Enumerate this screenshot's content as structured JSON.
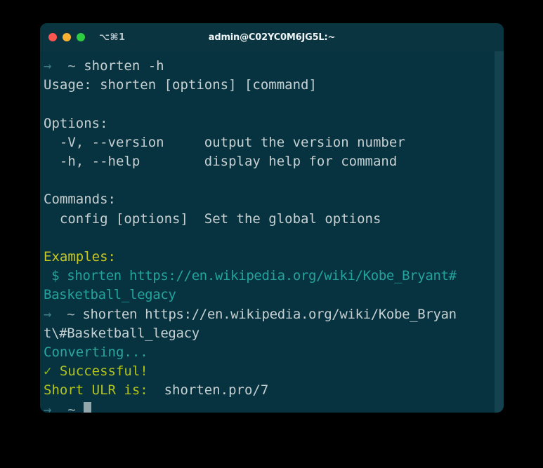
{
  "window": {
    "title": "admin@C02YC0M6JG5L:~",
    "tab_shortcut": "⌥⌘1",
    "traffic_lights": {
      "close": "close-button",
      "minimize": "minimize-button",
      "maximize": "maximize-button"
    },
    "colors": {
      "background": "#06333f",
      "titlebar": "#0a3440",
      "desktop": "#000000",
      "text": "#c6d0d2",
      "teal": "#23a39c",
      "yellow": "#c8c820",
      "olive": "#b3c41c",
      "arrow": "#41808a",
      "scrollbar": "#14424f",
      "red_light": "#f9564f",
      "yellow_light": "#f9b132",
      "green_light": "#2ecc40"
    }
  },
  "terminal": {
    "lines": [
      {
        "id": "prompt-help",
        "segments": [
          {
            "text": "→",
            "class": "arrow"
          },
          {
            "text": "  ",
            "class": "plain"
          },
          {
            "text": "~",
            "class": "tilde"
          },
          {
            "text": " shorten -h",
            "class": "plain"
          }
        ]
      },
      {
        "id": "usage",
        "segments": [
          {
            "text": "Usage: shorten [options] [command]",
            "class": "plain"
          }
        ]
      },
      {
        "id": "blank-1",
        "segments": [
          {
            "text": " ",
            "class": "plain"
          }
        ]
      },
      {
        "id": "options-header",
        "segments": [
          {
            "text": "Options:",
            "class": "plain"
          }
        ]
      },
      {
        "id": "option-version",
        "segments": [
          {
            "text": "  -V, --version     output the version number",
            "class": "plain"
          }
        ]
      },
      {
        "id": "option-help",
        "segments": [
          {
            "text": "  -h, --help        display help for command",
            "class": "plain"
          }
        ]
      },
      {
        "id": "blank-2",
        "segments": [
          {
            "text": " ",
            "class": "plain"
          }
        ]
      },
      {
        "id": "commands-header",
        "segments": [
          {
            "text": "Commands:",
            "class": "plain"
          }
        ]
      },
      {
        "id": "command-config",
        "segments": [
          {
            "text": "  config [options]  Set the global options",
            "class": "plain"
          }
        ]
      },
      {
        "id": "blank-3",
        "segments": [
          {
            "text": " ",
            "class": "plain"
          }
        ]
      },
      {
        "id": "examples-header",
        "segments": [
          {
            "text": "Examples:",
            "class": "yellow"
          }
        ]
      },
      {
        "id": "example-command",
        "wrap": true,
        "segments": [
          {
            "text": " $ shorten https://en.wikipedia.org/wiki/Kobe_Bryant#",
            "class": "teal"
          }
        ]
      },
      {
        "id": "example-command-wrap",
        "wrap": true,
        "segments": [
          {
            "text": "Basketball_legacy",
            "class": "teal"
          }
        ]
      },
      {
        "id": "prompt-shorten",
        "wrap": true,
        "segments": [
          {
            "text": "→",
            "class": "arrow"
          },
          {
            "text": "  ",
            "class": "plain"
          },
          {
            "text": "~",
            "class": "tilde"
          },
          {
            "text": " shorten https://en.wikipedia.org/wiki/Kobe_Bryan",
            "class": "plain"
          }
        ]
      },
      {
        "id": "prompt-shorten-wrap",
        "wrap": true,
        "segments": [
          {
            "text": "t\\#Basketball_legacy",
            "class": "plain"
          }
        ]
      },
      {
        "id": "status-converting",
        "segments": [
          {
            "text": "Converting...",
            "class": "cyan"
          }
        ]
      },
      {
        "id": "status-successful",
        "segments": [
          {
            "text": "✓",
            "class": "check"
          },
          {
            "text": " Successful!",
            "class": "olive"
          }
        ]
      },
      {
        "id": "short-url-result",
        "segments": [
          {
            "text": "Short ULR is:",
            "class": "olive"
          },
          {
            "text": "  shorten.pro/7",
            "class": "white"
          }
        ]
      },
      {
        "id": "prompt-final",
        "cursor": true,
        "segments": [
          {
            "text": "→",
            "class": "arrow"
          },
          {
            "text": "  ",
            "class": "plain"
          },
          {
            "text": "~",
            "class": "tilde"
          },
          {
            "text": " ",
            "class": "plain"
          }
        ]
      }
    ]
  }
}
